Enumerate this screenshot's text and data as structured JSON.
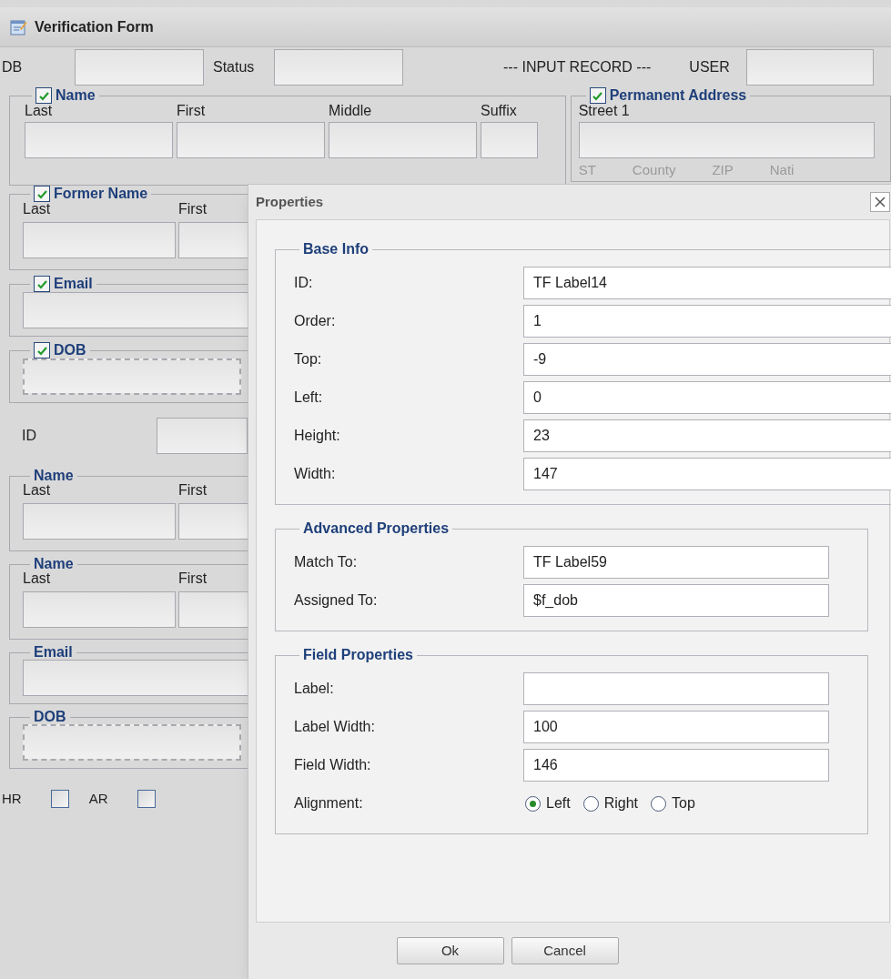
{
  "window": {
    "title": "Verification Form"
  },
  "header": {
    "fields": [
      {
        "label": "DB"
      },
      {
        "label": "Status"
      }
    ],
    "record_caption": "--- INPUT RECORD ---",
    "user": {
      "label": "USER"
    }
  },
  "name_group": {
    "title": "Name",
    "checked": true,
    "columns": [
      "Last",
      "First",
      "Middle",
      "Suffix"
    ]
  },
  "address_group": {
    "title": "Permanent Address",
    "checked": true,
    "street_label": "Street 1",
    "columns": [
      "ST",
      "County",
      "ZIP",
      "Nati"
    ]
  },
  "left_groups": [
    {
      "kind": "name",
      "title": "Former Name",
      "checked": true,
      "columns": [
        "Last",
        "First"
      ]
    },
    {
      "kind": "single",
      "title": "Email",
      "checked": true
    },
    {
      "kind": "dashed",
      "title": "DOB",
      "checked": true
    },
    {
      "kind": "id",
      "title": "ID"
    },
    {
      "kind": "name",
      "title": "Name",
      "columns": [
        "Last",
        "First"
      ]
    },
    {
      "kind": "name",
      "title": "Name",
      "columns": [
        "Last",
        "First"
      ]
    },
    {
      "kind": "single",
      "title": "Email"
    },
    {
      "kind": "dashed",
      "title": "DOB"
    }
  ],
  "flags": [
    {
      "label": "HR",
      "checked": false
    },
    {
      "label": "AR",
      "checked": false
    }
  ],
  "dialog": {
    "title": "Properties",
    "sections": [
      {
        "title": "Base Info",
        "wide": true,
        "rows": [
          {
            "kind": "text",
            "label": "ID:",
            "value": "TF Label14"
          },
          {
            "kind": "text",
            "label": "Order:",
            "value": "1"
          },
          {
            "kind": "text",
            "label": "Top:",
            "value": "-9"
          },
          {
            "kind": "text",
            "label": "Left:",
            "value": "0"
          },
          {
            "kind": "text",
            "label": "Height:",
            "value": "23"
          },
          {
            "kind": "text",
            "label": "Width:",
            "value": "147"
          }
        ]
      },
      {
        "title": "Advanced Properties",
        "wide": false,
        "rows": [
          {
            "kind": "text",
            "label": "Match To:",
            "value": "TF Label59"
          },
          {
            "kind": "text",
            "label": "Assigned To:",
            "value": "$f_dob"
          }
        ]
      },
      {
        "title": "Field Properties",
        "wide": false,
        "rows": [
          {
            "kind": "text",
            "label": "Label:"
          },
          {
            "kind": "text",
            "label": "Label Width:",
            "value": "100"
          },
          {
            "kind": "text",
            "label": "Field Width:",
            "value": "146"
          },
          {
            "kind": "radio",
            "label": "Alignment:",
            "options": [
              {
                "label": "Left",
                "selected": true
              },
              {
                "label": "Right",
                "selected": false
              },
              {
                "label": "Top",
                "selected": false
              }
            ]
          }
        ]
      }
    ],
    "buttons": [
      "Ok",
      "Cancel"
    ]
  }
}
